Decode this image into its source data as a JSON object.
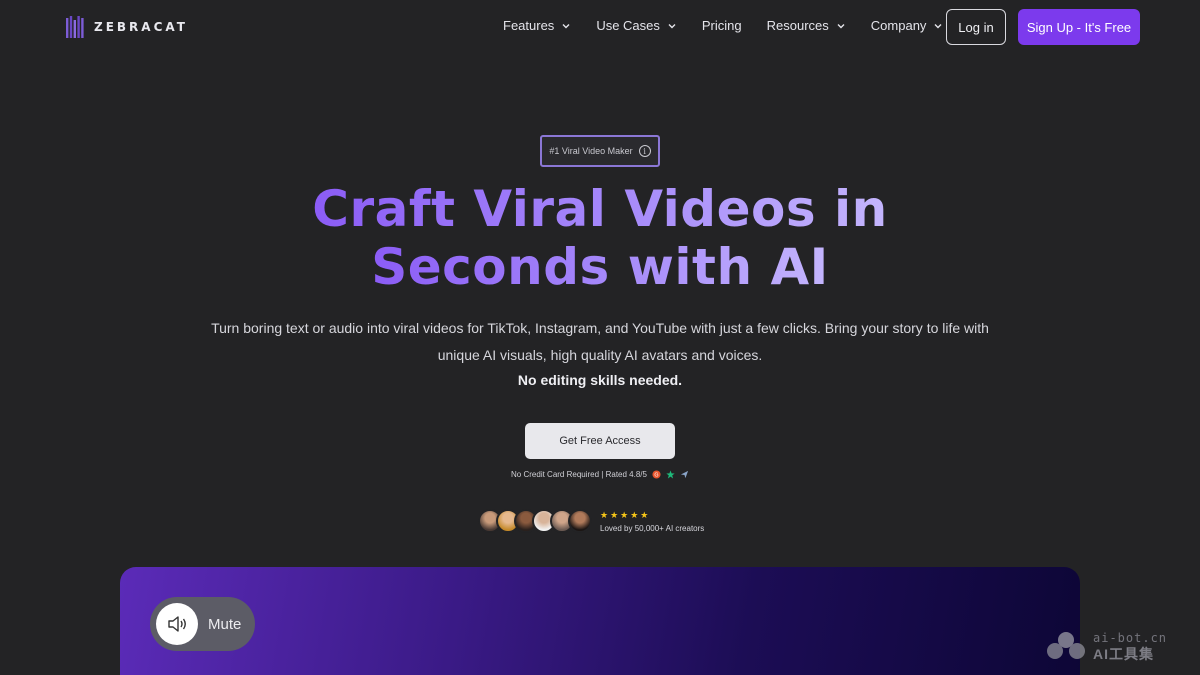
{
  "nav": {
    "logo_text": "ZEBRACAT",
    "menu": [
      {
        "label": "Features",
        "has_dropdown": true
      },
      {
        "label": "Use Cases",
        "has_dropdown": true
      },
      {
        "label": "Pricing",
        "has_dropdown": false
      },
      {
        "label": "Resources",
        "has_dropdown": true
      },
      {
        "label": "Company",
        "has_dropdown": true
      }
    ],
    "login_label": "Log in",
    "signup_label": "Sign Up - It's Free"
  },
  "hero": {
    "badge_label": "#1 Viral Video Maker",
    "headline_line1": "Craft Viral Videos in",
    "headline_line2": "Seconds with AI",
    "subtitle": "Turn boring text or audio into viral videos for TikTok, Instagram, and YouTube with just a few clicks. Bring your story to life with unique AI visuals, high quality AI avatars and voices.",
    "subtitle_bold": "No editing skills needed.",
    "cta_label": "Get Free Access",
    "rating_text": "No Credit Card Required | Rated 4.8/5",
    "stars": "★★★★★",
    "loved_text": "Loved by 50,000+ AI creators"
  },
  "video": {
    "mute_label": "Mute"
  },
  "watermark": {
    "top": "ai-bot.cn",
    "bottom": "AI工具集"
  },
  "colors": {
    "background": "#232325",
    "accent": "#7c3aed",
    "headline_gradient_start": "#8b5cf6",
    "headline_gradient_end": "#c4b5fd"
  }
}
